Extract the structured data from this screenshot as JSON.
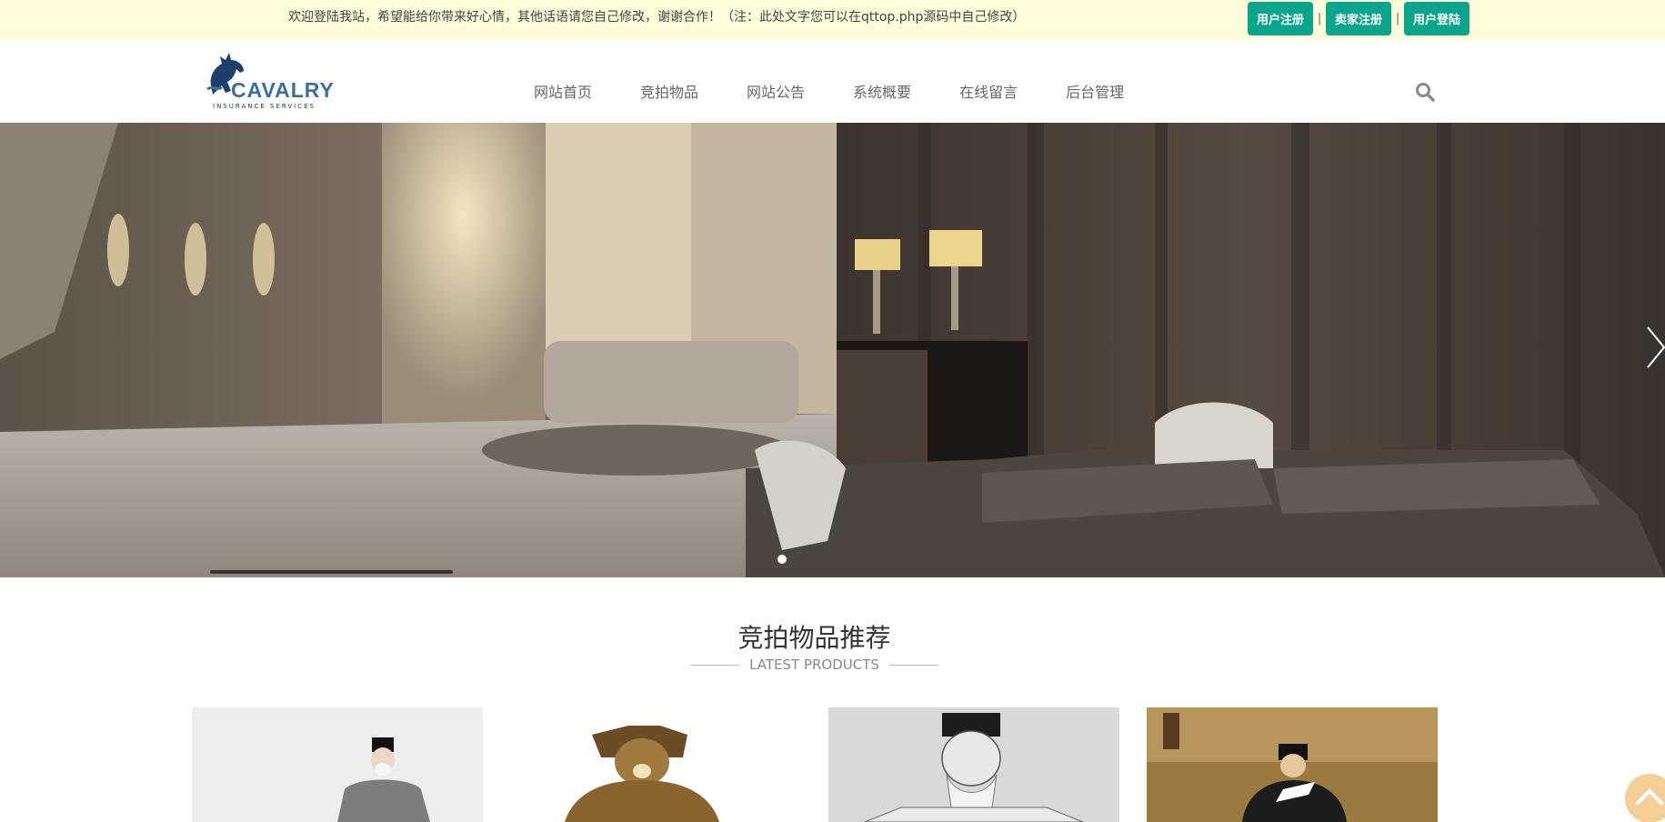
{
  "topbar": {
    "welcome": "欢迎登陆我站，希望能给你带来好心情，其他话语请您自己修改，谢谢合作！（注：此处文字您可以在qttop.php源码中自己修改）",
    "buttons": [
      "用户注册",
      "卖家注册",
      "用户登陆"
    ],
    "separator": "|"
  },
  "logo": {
    "brand": "CAVALRY",
    "tagline": "INSURANCE SERVICES"
  },
  "nav": {
    "items": [
      "网站首页",
      "竞拍物品",
      "网站公告",
      "系统概要",
      "在线留言",
      "后台管理"
    ]
  },
  "icons": {
    "search": "search-icon",
    "next": "chevron-right-icon",
    "back_to_top": "chevron-up-icon"
  },
  "section": {
    "title": "竞拍物品推荐",
    "subtitle": "LATEST PRODUCTS"
  },
  "colors": {
    "topbar_bg": "#fefcd9",
    "accent": "#0aa58a",
    "back_to_top": "#f5cf98"
  }
}
